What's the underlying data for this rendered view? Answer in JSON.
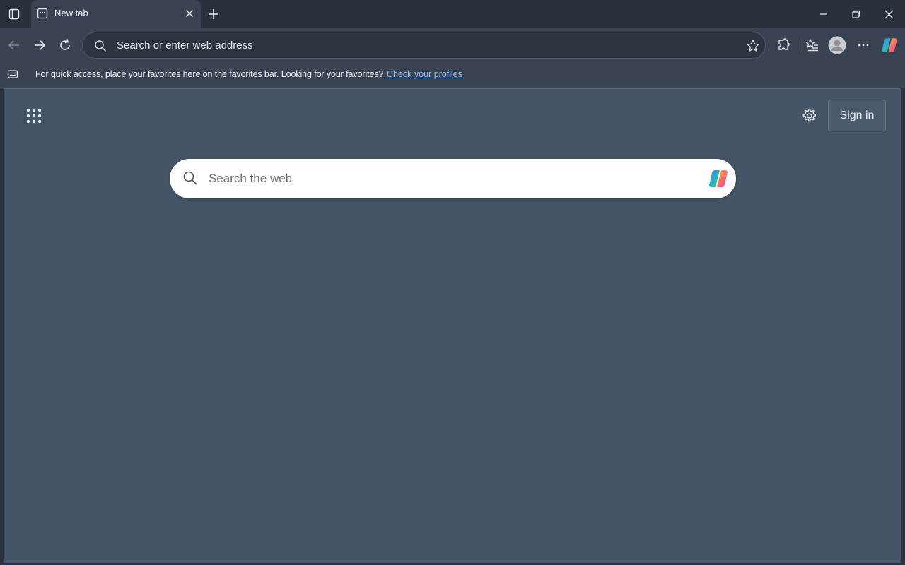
{
  "browser": {
    "tab": {
      "title": "New tab"
    },
    "address_bar": {
      "placeholder": "Search or enter web address"
    }
  },
  "favorites_bar": {
    "message": "For quick access, place your favorites here on the favorites bar. Looking for your favorites?",
    "link": "Check your profiles"
  },
  "new_tab_page": {
    "sign_in_label": "Sign in",
    "search": {
      "placeholder": "Search the web"
    }
  },
  "colors": {
    "page_background": "#465468",
    "toolbar": "#3a4352",
    "titlebar": "#29313d",
    "link": "#8cc4ff"
  },
  "icons": [
    "tab-actions-icon",
    "new-tab-page-icon",
    "close-icon",
    "plus-icon",
    "minimize-icon",
    "restore-icon",
    "back-icon",
    "forward-icon",
    "reload-icon",
    "search-icon",
    "star-icon",
    "extensions-icon",
    "favorites-icon",
    "profile-icon",
    "more-icon",
    "copilot-icon",
    "apps-grid-icon",
    "gear-icon"
  ]
}
